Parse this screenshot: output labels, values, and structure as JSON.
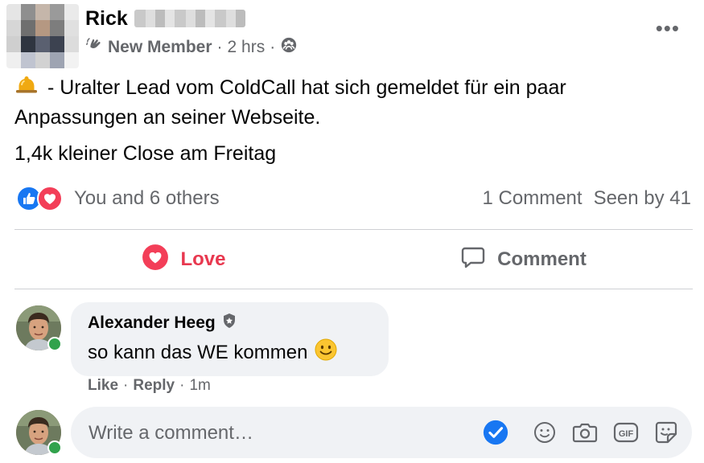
{
  "post": {
    "author_name": "Rick",
    "role": "New Member",
    "time": "2 hrs",
    "separator": "·",
    "audience_icon": "group-icon",
    "more_label": "•••",
    "text_line1": " - Uralter Lead vom ColdCall hat sich gemeldet für ein paar Anpassungen an seiner Webseite.",
    "text_line2": "1,4k kleiner Close am Freitag",
    "reactions_text": "You and 6 others",
    "comments_count": "1 Comment",
    "seen_by": "Seen by 41"
  },
  "actions": {
    "love_label": "Love",
    "comment_label": "Comment"
  },
  "comment": {
    "author": "Alexander Heeg",
    "text": "so kann das WE kommen",
    "like_label": "Like",
    "reply_label": "Reply",
    "time": "1m",
    "separator": "·"
  },
  "composer": {
    "placeholder": "Write a comment…",
    "value": ""
  },
  "colors": {
    "like_blue": "#1877f2",
    "love_red": "#e8384f",
    "online_green": "#31a24c",
    "bubble_gray": "#f0f2f5",
    "secondary_text": "#65676b"
  },
  "icons": [
    "wave-icon",
    "group-icon",
    "bell-icon",
    "like-reaction-icon",
    "love-reaction-icon",
    "heart-icon",
    "speech-bubble-icon",
    "shield-badge-icon",
    "smiley-emoji-icon",
    "check-icon",
    "emoji-icon",
    "camera-icon",
    "gif-icon",
    "sticker-icon"
  ]
}
